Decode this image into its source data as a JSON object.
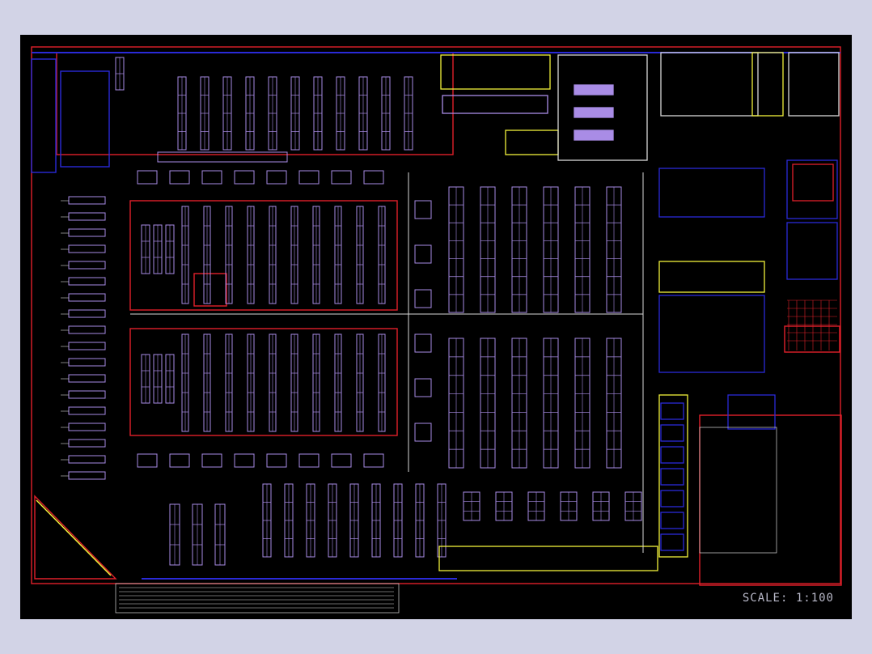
{
  "drawing": {
    "scale_label": "SCALE:  1:100"
  },
  "colors": {
    "background": "#000000",
    "frame": "#d2d3e6",
    "wall_red": "#e0202a",
    "wall_blue": "#2a2ad8",
    "fixture_purple": "#a98ce6",
    "highlight_yellow": "#f2f23a",
    "line_white": "#d8d8d8"
  }
}
